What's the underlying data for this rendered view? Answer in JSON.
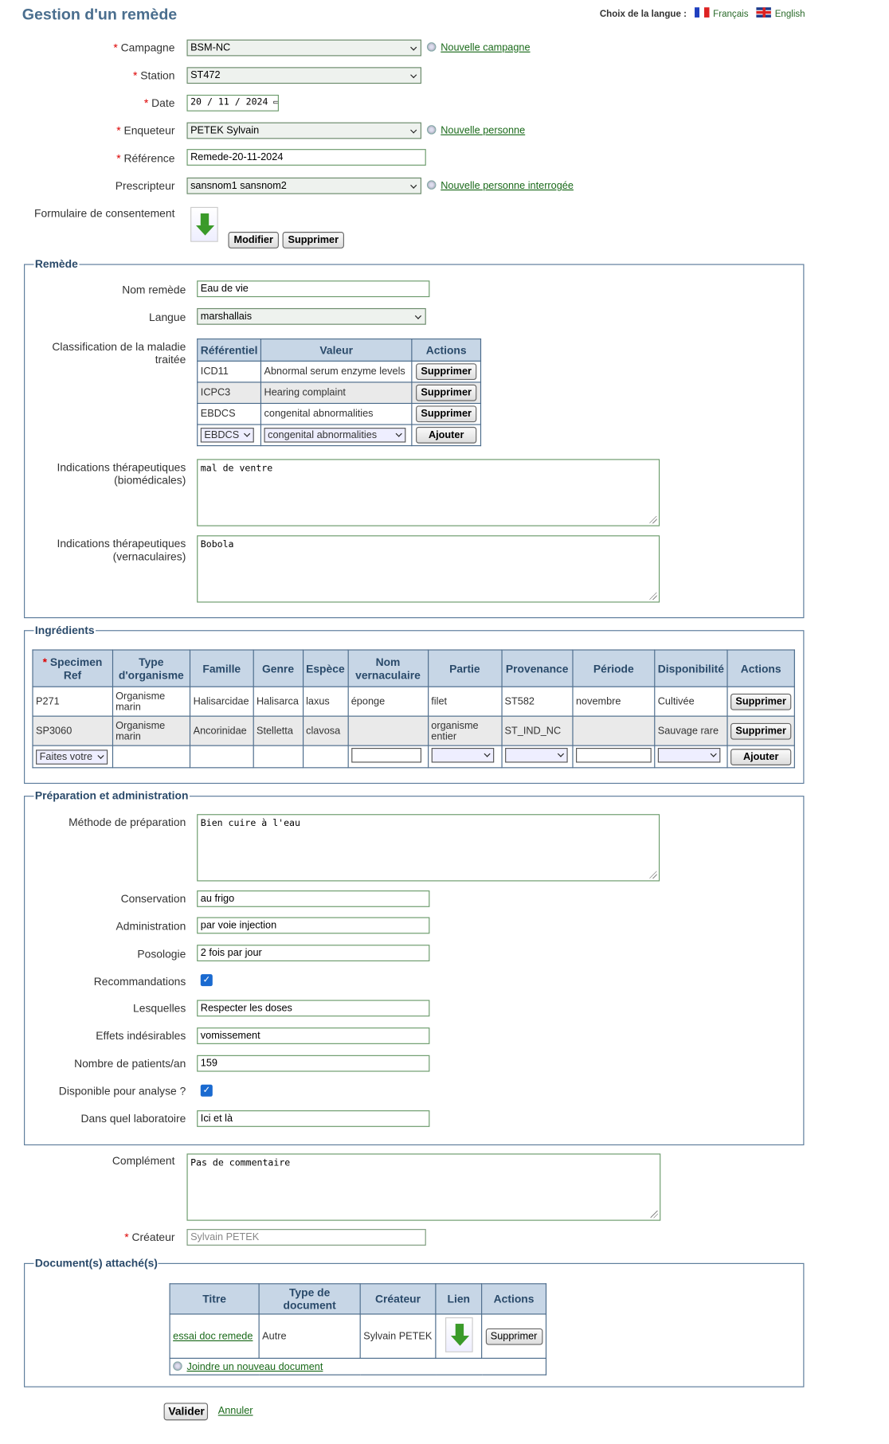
{
  "header": {
    "title": "Gestion d'un remède",
    "lang_label": "Choix de la langue :",
    "lang_fr": "Français",
    "lang_en": "English"
  },
  "form": {
    "campagne": {
      "label": "Campagne",
      "value": "BSM-NC",
      "link": "Nouvelle campagne"
    },
    "station": {
      "label": "Station",
      "value": "ST472"
    },
    "date": {
      "label": "Date",
      "value": "20 / 11 / 2024"
    },
    "enqueteur": {
      "label": "Enqueteur",
      "value": "PETEK Sylvain",
      "link": "Nouvelle personne"
    },
    "reference": {
      "label": "Référence",
      "value": "Remede-20-11-2024"
    },
    "prescripteur": {
      "label": "Prescripteur",
      "value": "sansnom1 sansnom2",
      "link": "Nouvelle personne interrogée"
    },
    "consentement": {
      "label": "Formulaire de consentement",
      "modifier": "Modifier",
      "supprimer": "Supprimer"
    }
  },
  "remede": {
    "legend": "Remède",
    "nom": {
      "label": "Nom remède",
      "value": "Eau de vie"
    },
    "langue": {
      "label": "Langue",
      "value": "marshallais"
    },
    "classif": {
      "label": "Classification de la maladie traitée",
      "headers": [
        "Référentiel",
        "Valeur",
        "Actions"
      ],
      "rows": [
        [
          "ICD11",
          "Abnormal serum enzyme levels",
          "Supprimer"
        ],
        [
          "ICPC3",
          "Hearing complaint",
          "Supprimer"
        ],
        [
          "EBDCS",
          "congenital abnormalities",
          "Supprimer"
        ]
      ],
      "new": {
        "ref": "EBDCS",
        "val": "congenital abnormalities",
        "btn": "Ajouter"
      }
    },
    "ind_bio": {
      "label": "Indications thérapeutiques (biomédicales)",
      "value": "mal de ventre"
    },
    "ind_vern": {
      "label": "Indications thérapeutiques (vernaculaires)",
      "value": "Bobola"
    }
  },
  "ingredients": {
    "legend": "Ingrédients",
    "headers": [
      "Specimen Ref",
      "Type d'organisme",
      "Famille",
      "Genre",
      "Espèce",
      "Nom vernaculaire",
      "Partie",
      "Provenance",
      "Période",
      "Disponibilité",
      "Actions"
    ],
    "rows": [
      [
        "P271",
        "Organisme marin",
        "Halisarcidae",
        "Halisarca",
        "laxus",
        "éponge",
        "filet",
        "ST582",
        "novembre",
        "Cultivée",
        "Supprimer"
      ],
      [
        "SP3060",
        "Organisme marin",
        "Ancorinidae",
        "Stelletta",
        "clavosa",
        "",
        "organisme entier",
        "ST_IND_NC",
        "",
        "Sauvage rare",
        "Supprimer"
      ]
    ],
    "new": {
      "specimen": "Faites votre",
      "btn": "Ajouter"
    }
  },
  "prep": {
    "legend": "Préparation et administration",
    "methode": {
      "label": "Méthode de préparation",
      "value": "Bien cuire à l'eau"
    },
    "conservation": {
      "label": "Conservation",
      "value": "au frigo"
    },
    "administration": {
      "label": "Administration",
      "value": "par voie injection"
    },
    "posologie": {
      "label": "Posologie",
      "value": "2 fois par jour"
    },
    "recommandations": {
      "label": "Recommandations",
      "checked": true
    },
    "lesquelles": {
      "label": "Lesquelles",
      "value": "Respecter les doses"
    },
    "effets": {
      "label": "Effets indésirables",
      "value": "vomissement"
    },
    "patients": {
      "label": "Nombre de patients/an",
      "value": "159"
    },
    "dispo": {
      "label": "Disponible pour analyse ?",
      "checked": true
    },
    "labo": {
      "label": "Dans quel laboratoire",
      "value": "Ici et là"
    }
  },
  "complement": {
    "label": "Complément",
    "value": "Pas de commentaire"
  },
  "createur": {
    "label": "Créateur",
    "value": "Sylvain PETEK"
  },
  "docs": {
    "legend": "Document(s) attaché(s)",
    "headers": [
      "Titre",
      "Type de document",
      "Créateur",
      "Lien",
      "Actions"
    ],
    "rows": [
      [
        "essai doc remede",
        "Autre",
        "Sylvain PETEK",
        "",
        "Supprimer"
      ]
    ],
    "join": "Joindre un nouveau document"
  },
  "footer": {
    "valider": "Valider",
    "annuler": "Annuler"
  },
  "colors": {
    "header_bg": "#c7d6e6",
    "title": "#4a6e8e",
    "link": "#1a6a1a",
    "border": "#5a7a9a"
  }
}
